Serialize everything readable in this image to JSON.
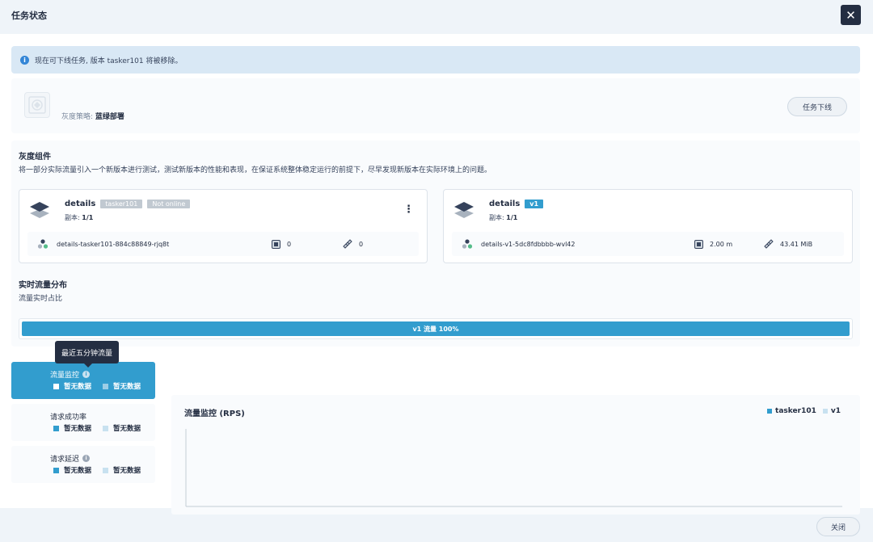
{
  "header": {
    "title": "任务状态"
  },
  "info_bar": {
    "message": "现在可下线任务, 版本 tasker101 将被移除。"
  },
  "strategy": {
    "label": "灰度策略:",
    "value": "蓝绿部署",
    "offline_button": "任务下线"
  },
  "components": {
    "title": "灰度组件",
    "description": "将一部分实际流量引入一个新版本进行测试，测试新版本的性能和表现，在保证系统整体稳定运行的前提下，尽早发现新版本在实际环境上的问题。",
    "cards": [
      {
        "name": "details",
        "tags": [
          "tasker101",
          "Not online"
        ],
        "replica_label": "副本:",
        "replica_value": "1/1",
        "pod": "details-tasker101-884c88849-rjq8t",
        "cpu": "0",
        "memory": "0"
      },
      {
        "name": "details",
        "tags": [
          "v1"
        ],
        "replica_label": "副本:",
        "replica_value": "1/1",
        "pod": "details-v1-5dc8fdbbbb-wvl42",
        "cpu": "2.00 m",
        "memory": "43.41 MiB"
      }
    ]
  },
  "traffic": {
    "title": "实时流量分布",
    "subtitle": "流量实时占比",
    "bar_label": "v1 流量 100%",
    "v1_percent": 100
  },
  "monitor_tabs": [
    {
      "title": "流量监控",
      "legend1": "暂无数据",
      "legend2": "暂无数据",
      "has_info": true
    },
    {
      "title": "请求成功率",
      "legend1": "暂无数据",
      "legend2": "暂无数据",
      "has_info": false
    },
    {
      "title": "请求延迟",
      "legend1": "暂无数据",
      "legend2": "暂无数据",
      "has_info": true
    }
  ],
  "tooltip": "最近五分钟流量",
  "chart": {
    "title": "流量监控 (RPS)",
    "legend": [
      "tasker101",
      "v1"
    ]
  },
  "footer": {
    "close_button": "关闭"
  },
  "colors": {
    "accent": "#329dce",
    "dark": "#242e42",
    "light_series": "#c8e1f0"
  },
  "chart_data": {
    "type": "line",
    "title": "流量监控 (RPS)",
    "series": [
      {
        "name": "tasker101",
        "values": []
      },
      {
        "name": "v1",
        "values": []
      }
    ],
    "legend": "top-right"
  }
}
